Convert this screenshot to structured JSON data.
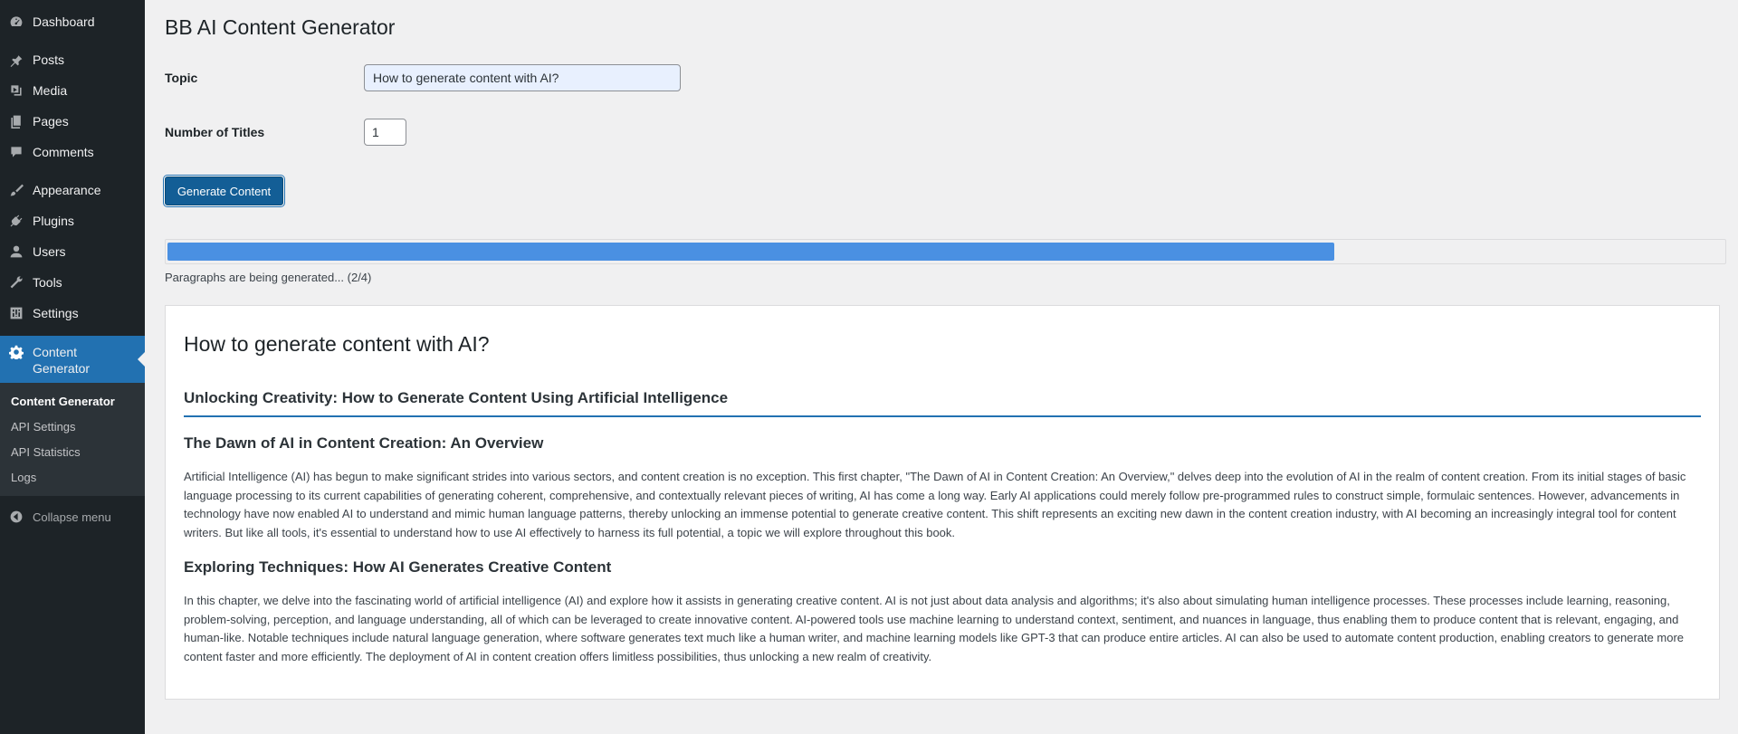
{
  "sidebar": {
    "items": [
      {
        "label": "Dashboard",
        "icon": "dashboard-icon"
      },
      {
        "label": "Posts",
        "icon": "pin-icon"
      },
      {
        "label": "Media",
        "icon": "media-icon"
      },
      {
        "label": "Pages",
        "icon": "pages-icon"
      },
      {
        "label": "Comments",
        "icon": "comment-icon"
      },
      {
        "label": "Appearance",
        "icon": "brush-icon"
      },
      {
        "label": "Plugins",
        "icon": "plugin-icon"
      },
      {
        "label": "Users",
        "icon": "user-icon"
      },
      {
        "label": "Tools",
        "icon": "wrench-icon"
      },
      {
        "label": "Settings",
        "icon": "settings-icon"
      }
    ],
    "active": {
      "label": "Content Generator",
      "icon": "gear-icon"
    },
    "submenu": [
      "Content Generator",
      "API Settings",
      "API Statistics",
      "Logs"
    ],
    "collapse_label": "Collapse menu"
  },
  "page": {
    "title": "BB AI Content Generator",
    "topic_label": "Topic",
    "topic_value": "How to generate content with AI?",
    "num_titles_label": "Number of Titles",
    "num_titles_value": "1",
    "generate_button": "Generate Content",
    "progress_percent": 75,
    "status_text": "Paragraphs are being generated... (2/4)"
  },
  "content": {
    "topic_title": "How to generate content with AI?",
    "book_title": "Unlocking Creativity: How to Generate Content Using Artificial Intelligence",
    "chapters": [
      {
        "heading": "The Dawn of AI in Content Creation: An Overview",
        "text": "Artificial Intelligence (AI) has begun to make significant strides into various sectors, and content creation is no exception. This first chapter, \"The Dawn of AI in Content Creation: An Overview,\" delves deep into the evolution of AI in the realm of content creation. From its initial stages of basic language processing to its current capabilities of generating coherent, comprehensive, and contextually relevant pieces of writing, AI has come a long way. Early AI applications could merely follow pre-programmed rules to construct simple, formulaic sentences. However, advancements in technology have now enabled AI to understand and mimic human language patterns, thereby unlocking an immense potential to generate creative content. This shift represents an exciting new dawn in the content creation industry, with AI becoming an increasingly integral tool for content writers. But like all tools, it's essential to understand how to use AI effectively to harness its full potential, a topic we will explore throughout this book."
      },
      {
        "heading": "Exploring Techniques: How AI Generates Creative Content",
        "text": "In this chapter, we delve into the fascinating world of artificial intelligence (AI) and explore how it assists in generating creative content. AI is not just about data analysis and algorithms; it's also about simulating human intelligence processes. These processes include learning, reasoning, problem-solving, perception, and language understanding, all of which can be leveraged to create innovative content. AI-powered tools use machine learning to understand context, sentiment, and nuances in language, thus enabling them to produce content that is relevant, engaging, and human-like. Notable techniques include natural language generation, where software generates text much like a human writer, and machine learning models like GPT-3 that can produce entire articles. AI can also be used to automate content production, enabling creators to generate more content faster and more efficiently. The deployment of AI in content creation offers limitless possibilities, thus unlocking a new realm of creativity."
      }
    ]
  },
  "colors": {
    "sidebar_bg": "#1d2327",
    "accent": "#2271b1",
    "button_bg": "#135e96",
    "progress_fill": "#4a90e2",
    "page_bg": "#f0f0f1"
  }
}
